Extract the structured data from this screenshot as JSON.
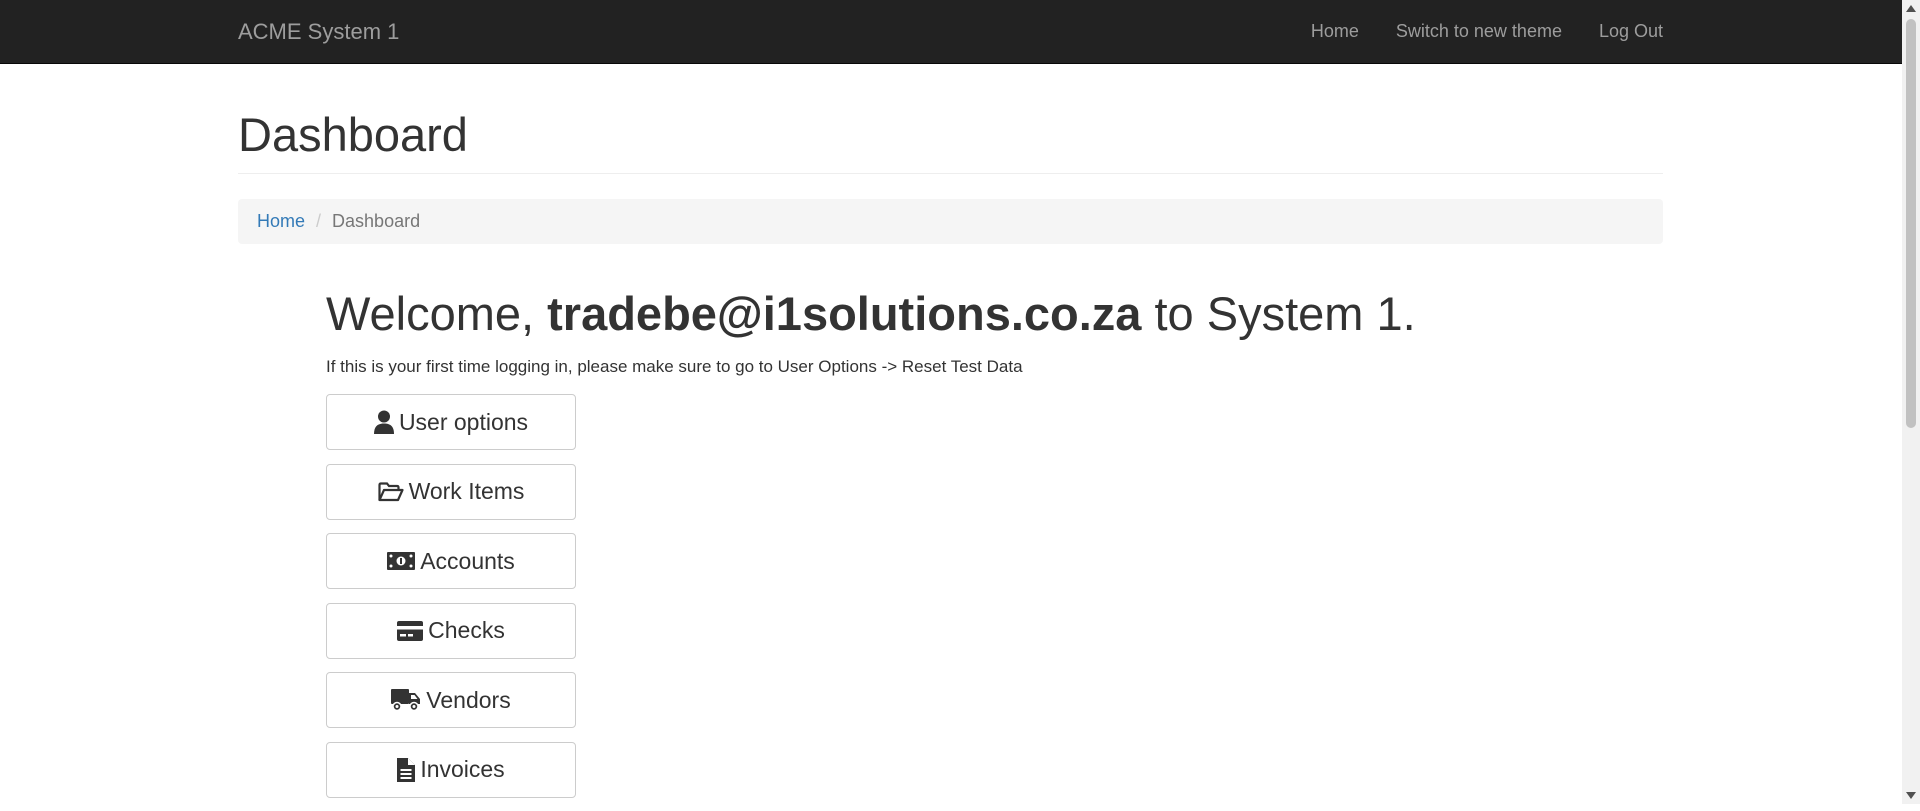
{
  "navbar": {
    "brand": "ACME System 1",
    "links": [
      "Home",
      "Switch to new theme",
      "Log Out"
    ]
  },
  "page": {
    "title": "Dashboard",
    "breadcrumb": {
      "home": "Home",
      "separator": "/",
      "current": "Dashboard"
    }
  },
  "welcome": {
    "prefix": "Welcome, ",
    "user": "tradebe@i1solutions.co.za",
    "suffix": " to System 1.",
    "hint": "If this is your first time logging in, please make sure to go to User Options -> Reset Test Data"
  },
  "buttons": [
    {
      "label": "User options",
      "icon": "user-icon"
    },
    {
      "label": "Work Items",
      "icon": "folder-open-icon"
    },
    {
      "label": "Accounts",
      "icon": "money-bill-icon"
    },
    {
      "label": "Checks",
      "icon": "credit-card-icon"
    },
    {
      "label": "Vendors",
      "icon": "truck-icon"
    },
    {
      "label": "Invoices",
      "icon": "file-text-icon"
    }
  ],
  "colors": {
    "navbar_bg": "#222222",
    "navbar_text": "#9d9d9d",
    "link": "#337ab7",
    "breadcrumb_bg": "#f5f5f5"
  }
}
